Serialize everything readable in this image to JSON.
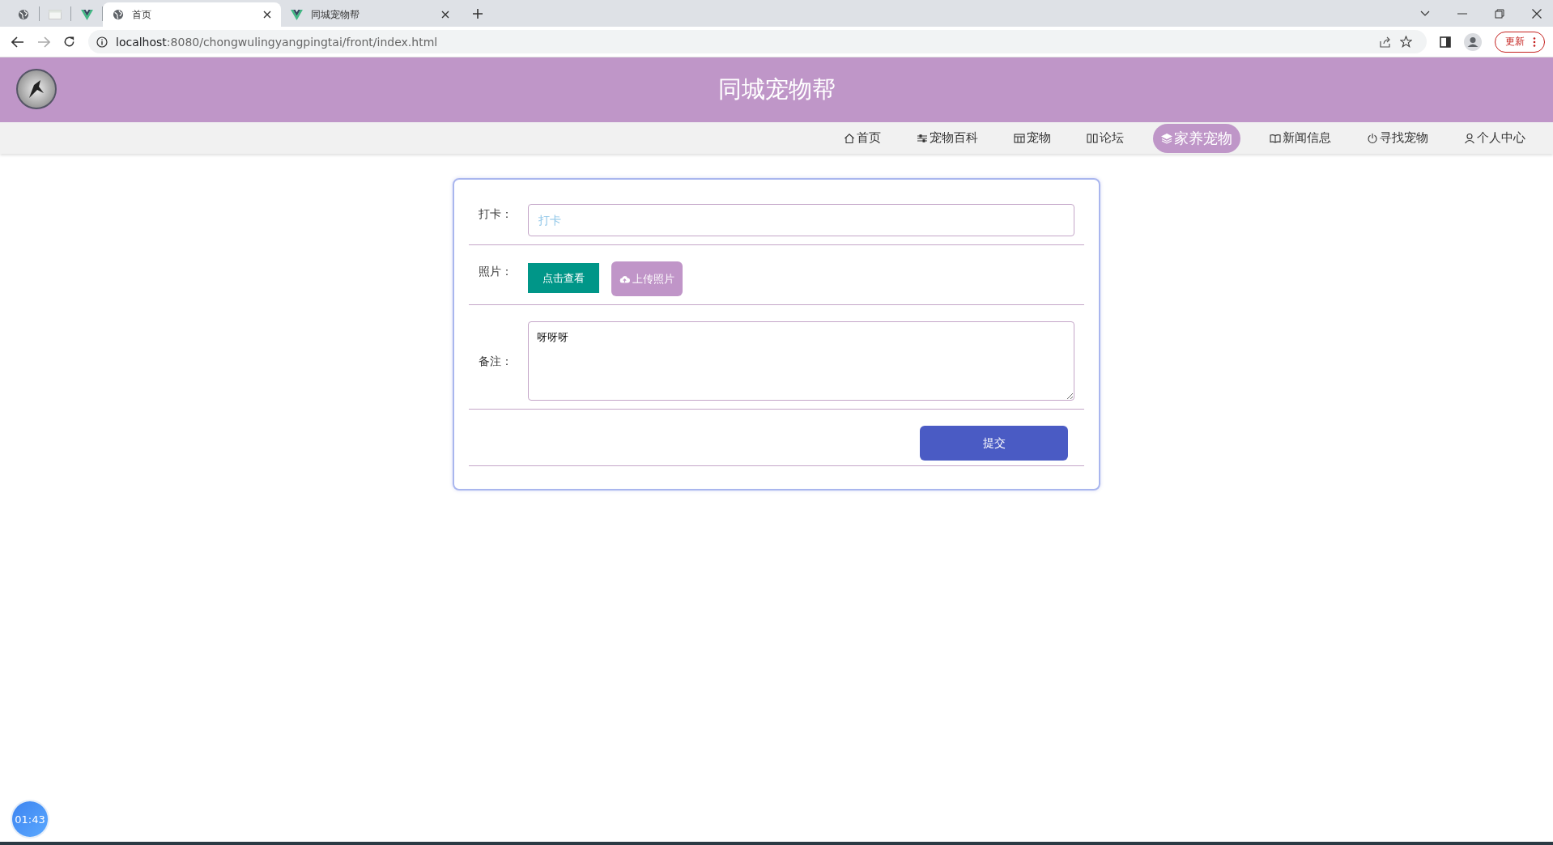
{
  "browser": {
    "tabs": [
      {
        "kind": "globe",
        "selected": false
      },
      {
        "kind": "page",
        "selected": false
      },
      {
        "kind": "vue",
        "selected": false
      },
      {
        "kind": "globe",
        "label": "首页",
        "selected": true
      },
      {
        "kind": "vue",
        "label": "同城宠物帮",
        "selected": false
      }
    ],
    "url_host": "localhost",
    "url_rest": ":8080/chongwulingyangpingtai/front/index.html",
    "update_button": "更新"
  },
  "header": {
    "title": "同城宠物帮"
  },
  "nav": [
    {
      "kind": "home",
      "label": "首页",
      "selected": false
    },
    {
      "kind": "sliders",
      "label": "宠物百科",
      "selected": false
    },
    {
      "kind": "grid",
      "label": "宠物",
      "selected": false
    },
    {
      "kind": "columns",
      "label": "论坛",
      "selected": false
    },
    {
      "kind": "layers",
      "label": "家养宠物",
      "selected": true
    },
    {
      "kind": "book",
      "label": "新闻信息",
      "selected": false
    },
    {
      "kind": "power",
      "label": "寻找宠物",
      "selected": false
    },
    {
      "kind": "user",
      "label": "个人中心",
      "selected": false
    }
  ],
  "form": {
    "checkin_label": "打卡：",
    "checkin_placeholder": "打卡",
    "photo_label": "照片：",
    "view_button": "点击查看",
    "upload_button": "上传照片",
    "note_label": "备注：",
    "note_value": "呀呀呀",
    "submit_button": "提交"
  },
  "timer": "01:43"
}
